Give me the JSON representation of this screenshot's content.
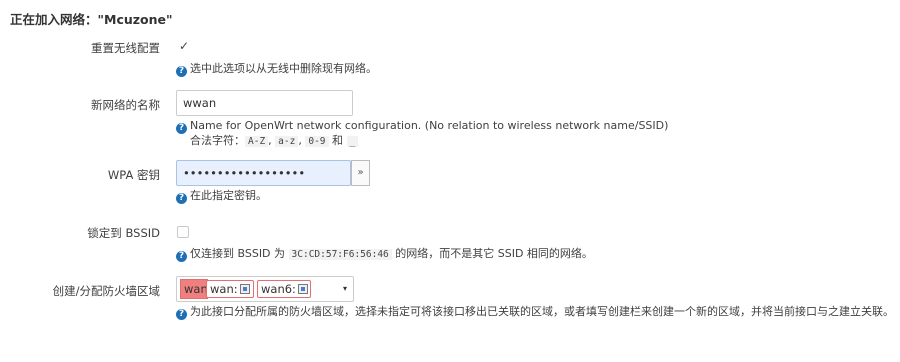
{
  "heading": "正在加入网络：\"Mcuzone\"",
  "fields": {
    "reset_wireless": {
      "label": "重置无线配置",
      "checked": true,
      "help": "选中此选项以从无线中删除现有网络。"
    },
    "network_name": {
      "label": "新网络的名称",
      "value": "wwan",
      "help_line1": "Name for OpenWrt network configuration. (No relation to wireless network name/SSID)",
      "help_line2_prefix": "合法字符：",
      "chars": [
        "A-Z",
        "a-z",
        "0-9"
      ],
      "sep1": ",",
      "sep2": ",",
      "and": "和",
      "underscore": "_"
    },
    "wpa_key": {
      "label": "WPA 密钥",
      "value": "••••••••••••••••••",
      "reveal_button": "»",
      "help": "在此指定密钥。"
    },
    "lock_bssid": {
      "label": "锁定到 BSSID",
      "checked": false,
      "help_prefix": "仅连接到 BSSID 为",
      "bssid": "3C:CD:57:F6:56:46",
      "help_suffix": "的网络，而不是其它 SSID 相同的网络。"
    },
    "firewall_zone": {
      "label": "创建/分配防火墙区域",
      "zone_name": "wan",
      "networks": [
        "wan:",
        "wan6:"
      ],
      "help": "为此接口分配所属的防火墙区域，选择未指定可将该接口移出已关联的区域，或者填写创建栏来创建一个新的区域，并将当前接口与之建立关联。"
    }
  },
  "icons": {
    "help": "help-circle-icon",
    "checkmark": "checkmark-icon",
    "network": "network-interface-icon",
    "dropdown": "chevron-down-icon"
  },
  "colors": {
    "help_icon": "#1f6fb5",
    "zone_wan": "#f08080",
    "password_autofill": "#e8f0fe"
  }
}
